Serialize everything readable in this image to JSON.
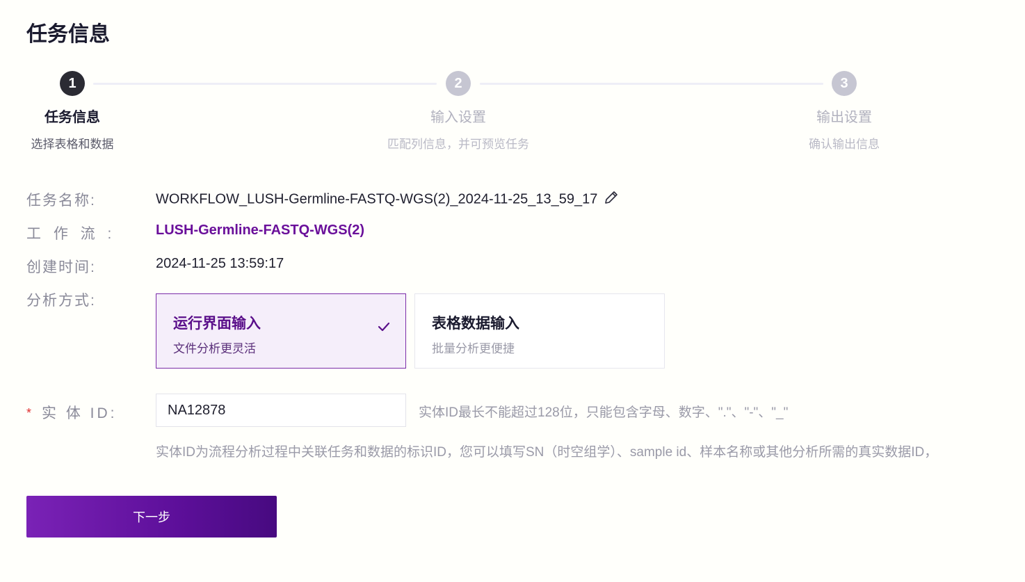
{
  "page_title": "任务信息",
  "steps": [
    {
      "number": "1",
      "title": "任务信息",
      "desc": "选择表格和数据",
      "state": "active"
    },
    {
      "number": "2",
      "title": "输入设置",
      "desc": "匹配列信息，并可预览任务",
      "state": "inactive"
    },
    {
      "number": "3",
      "title": "输出设置",
      "desc": "确认输出信息",
      "state": "inactive"
    }
  ],
  "form": {
    "task_name_label": "任务名称:",
    "task_name_value": "WORKFLOW_LUSH-Germline-FASTQ-WGS(2)_2024-11-25_13_59_17",
    "workflow_label": "工 作 流 :",
    "workflow_value": "LUSH-Germline-FASTQ-WGS(2)",
    "created_label": "创建时间:",
    "created_value": "2024-11-25 13:59:17",
    "mode_label": "分析方式:",
    "mode_options": [
      {
        "title": "运行界面输入",
        "sub": "文件分析更灵活",
        "selected": true
      },
      {
        "title": "表格数据输入",
        "sub": "批量分析更便捷",
        "selected": false
      }
    ],
    "entity_required_mark": "*",
    "entity_label": "实 体 ID:",
    "entity_value": "NA12878",
    "entity_hint": "实体ID最长不能超过128位，只能包含字母、数字、\".\"、\"-\"、\"_\"",
    "entity_desc": "实体ID为流程分析过程中关联任务和数据的标识ID，您可以填写SN（时空组学）、sample id、样本名称或其他分析所需的真实数据ID，"
  },
  "next_button": "下一步",
  "colors": {
    "accent": "#6a0f9a",
    "step_active": "#2b2b33",
    "step_inactive": "#c6c6d2"
  }
}
